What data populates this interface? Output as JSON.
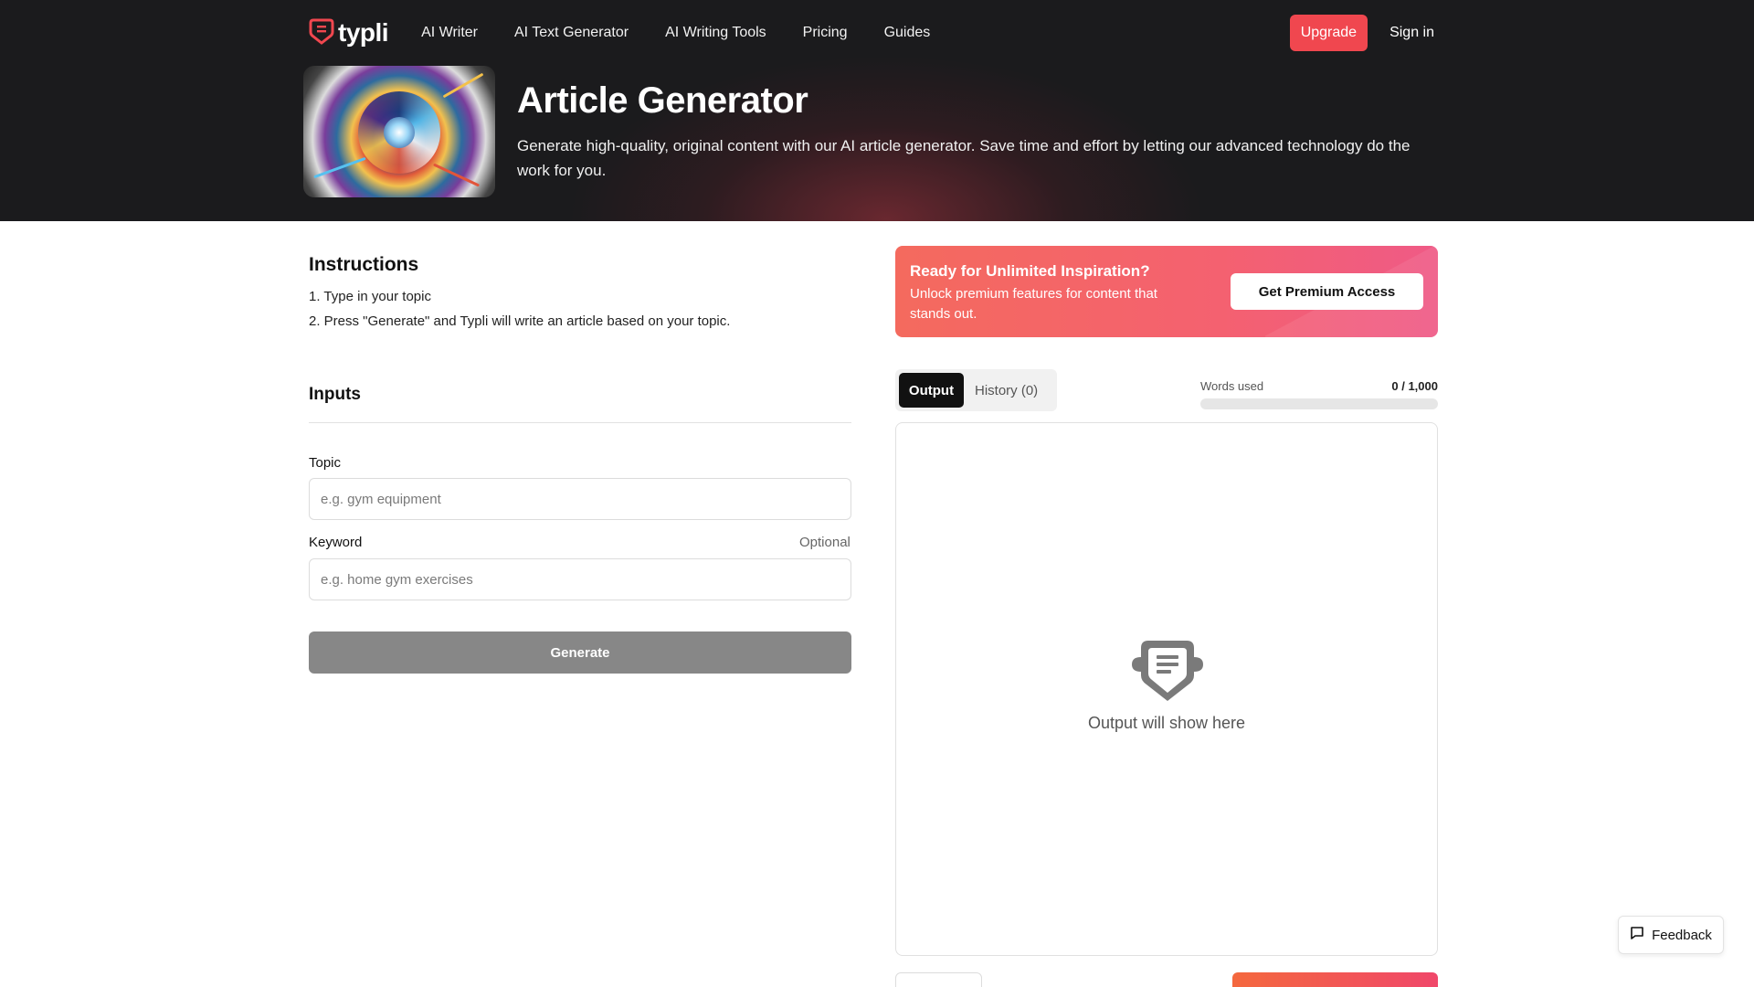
{
  "nav": {
    "logo_text": "typli",
    "links": [
      "AI Writer",
      "AI Text Generator",
      "AI Writing Tools",
      "Pricing",
      "Guides"
    ],
    "upgrade_label": "Upgrade",
    "signin_label": "Sign in"
  },
  "hero": {
    "title": "Article Generator",
    "description": "Generate high-quality, original content with our AI article generator. Save time and effort by letting our advanced technology do the work for you."
  },
  "instructions": {
    "title": "Instructions",
    "steps": [
      "1. Type in your topic",
      "2. Press \"Generate\" and Typli will write an article based on your topic."
    ]
  },
  "inputs": {
    "title": "Inputs",
    "topic_label": "Topic",
    "topic_placeholder": "e.g. gym equipment",
    "topic_value": "",
    "keyword_label": "Keyword",
    "keyword_optional": "Optional",
    "keyword_placeholder": "e.g. home gym exercises",
    "keyword_value": "",
    "generate_label": "Generate"
  },
  "promo": {
    "title": "Ready for Unlimited Inspiration?",
    "description": "Unlock premium features for content that stands out.",
    "button_label": "Get Premium Access"
  },
  "output": {
    "tabs": [
      "Output",
      "History (0)"
    ],
    "active_tab": "Output",
    "words_label": "Words used",
    "words_count": "0 / 1,000",
    "words_used_fraction": 0,
    "empty_text": "Output will show here"
  },
  "feedback": {
    "label": "Feedback"
  },
  "colors": {
    "brand": "#f0474f",
    "hero_bg": "#1b1b1d",
    "generate_disabled": "#878787"
  },
  "icons": [
    "typli-logo-icon",
    "output-placeholder-icon",
    "feedback-chat-icon"
  ]
}
